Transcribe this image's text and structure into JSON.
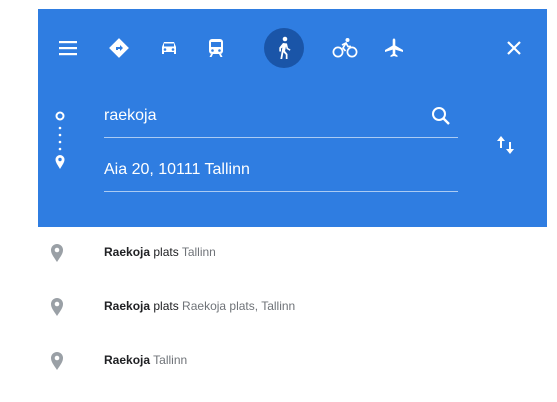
{
  "colors": {
    "header": "#2f7de1",
    "active_mode": "#1a55a8",
    "pin": "#9aa0a6"
  },
  "toolbar": {
    "icons": [
      "menu-icon",
      "directions-icon",
      "car-icon",
      "transit-icon",
      "walking-icon",
      "bicycle-icon",
      "flight-icon",
      "close-icon"
    ],
    "active": "walking-icon"
  },
  "route": {
    "origin_value": "raekoja",
    "destination_value": "Aia 20, 10111 Tallinn"
  },
  "suggestions": [
    {
      "bold": "Raekoja",
      "rest": " plats",
      "sub": " Tallinn"
    },
    {
      "bold": "Raekoja",
      "rest": " plats",
      "sub": " Raekoja plats, Tallinn"
    },
    {
      "bold": "Raekoja",
      "rest": "",
      "sub": " Tallinn"
    }
  ]
}
